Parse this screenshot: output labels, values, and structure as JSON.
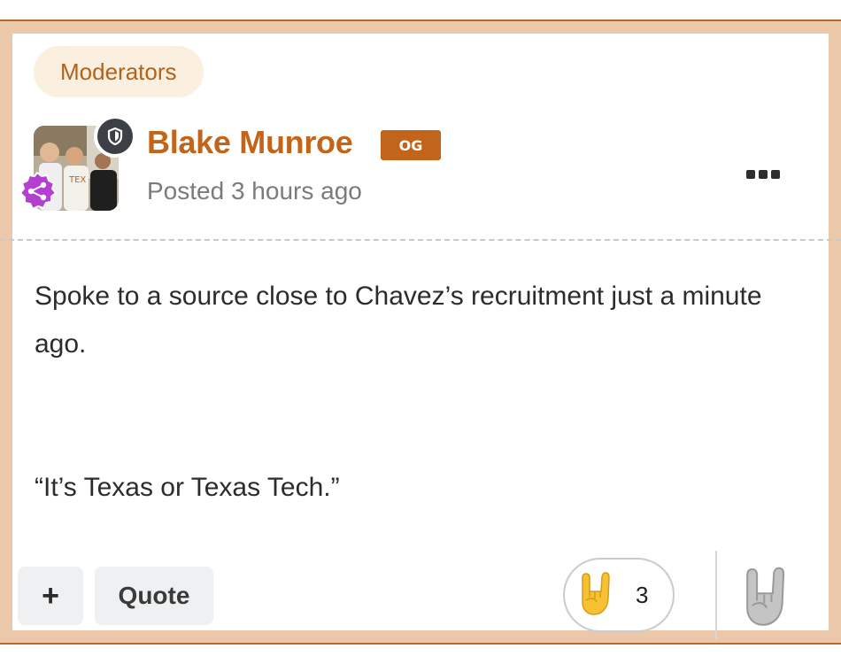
{
  "post": {
    "group_badge": "Moderators",
    "author": {
      "name": "Blake Munroe",
      "rank_badge": "OG",
      "avatar_icon": "user-avatar-photo",
      "moderator_icon": "shield-icon",
      "role_icon": "share-network-icon"
    },
    "meta": {
      "posted": "Posted 3 hours ago"
    },
    "more_icon": "ellipsis-icon",
    "body": {
      "line1": "Spoke to a source close to Chavez’s recruitment just a minute ago.",
      "line2": "“It’s Texas or Texas Tech.”"
    },
    "actions": {
      "plus_label": "+",
      "quote_label": "Quote"
    },
    "reactions": {
      "emoji_icon": "horns-hand-icon",
      "count": "3",
      "add_reaction_icon": "horns-hand-gray-icon"
    }
  },
  "colors": {
    "accent": "#c2651a",
    "frame": "#ecc8aa",
    "badge_bg": "#fbefdf",
    "muted_text": "#7b7b7b"
  }
}
